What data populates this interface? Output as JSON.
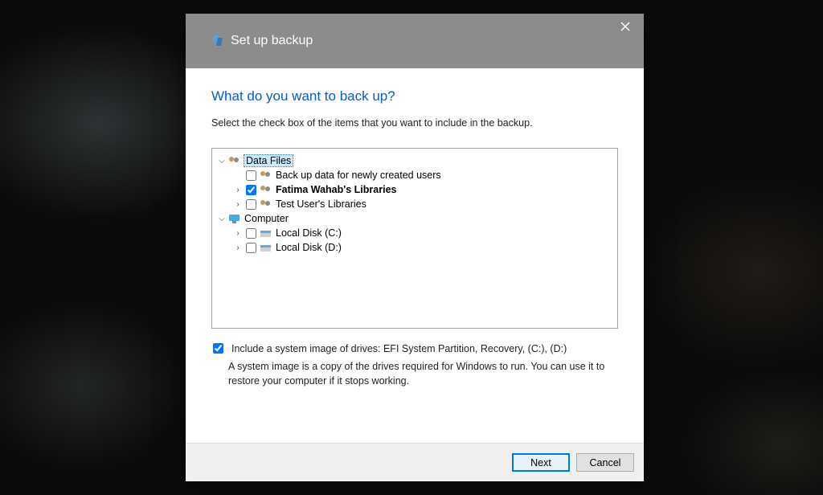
{
  "dialog": {
    "title": "Set up backup",
    "heading": "What do you want to back up?",
    "subtext": "Select the check box of the items that you want to include in the backup.",
    "tree": {
      "dataFiles": {
        "label": "Data Files",
        "items": {
          "newUsers": "Back up data for newly created users",
          "fatima": "Fatima Wahab's Libraries",
          "testUser": "Test User's Libraries"
        }
      },
      "computer": {
        "label": "Computer",
        "items": {
          "c": "Local Disk (C:)",
          "d": "Local Disk (D:)"
        }
      }
    },
    "systemImage": {
      "checkbox_label": "Include a system image of drives: EFI System Partition, Recovery, (C:), (D:)",
      "help": "A system image is a copy of the drives required for Windows to run. You can use it to restore your computer if it stops working."
    },
    "buttons": {
      "next": "Next",
      "cancel": "Cancel"
    }
  }
}
